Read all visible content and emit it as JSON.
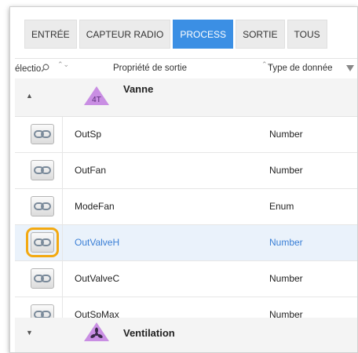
{
  "tabs": [
    {
      "label": "ENTRÉE"
    },
    {
      "label": "CAPTEUR RADIO"
    },
    {
      "label": "PROCESS"
    },
    {
      "label": "SORTIE"
    },
    {
      "label": "TOUS"
    }
  ],
  "active_tab": "PROCESS",
  "columns": {
    "select": "électio",
    "property": "Propriété de sortie",
    "type": "Type de donnée"
  },
  "groups": [
    {
      "badge": "4T",
      "title": "Vanne",
      "expanded": true,
      "icon": "triangle-badge-4t-icon"
    },
    {
      "badge": "",
      "title": "Ventilation",
      "expanded": false,
      "icon": "fan-badge-icon"
    }
  ],
  "rows": [
    {
      "name": "OutSp",
      "type": "Number",
      "selected": false
    },
    {
      "name": "OutFan",
      "type": "Number",
      "selected": false
    },
    {
      "name": "ModeFan",
      "type": "Enum",
      "selected": false
    },
    {
      "name": "OutValveH",
      "type": "Number",
      "selected": true
    },
    {
      "name": "OutValveC",
      "type": "Number",
      "selected": false
    },
    {
      "name": "OutSpMax",
      "type": "Number",
      "selected": false
    }
  ],
  "colors": {
    "active_tab": "#3b8fe4",
    "highlight": "#f3a911",
    "badge": "#c98ee3",
    "selected_row": "#eaf2fb"
  }
}
